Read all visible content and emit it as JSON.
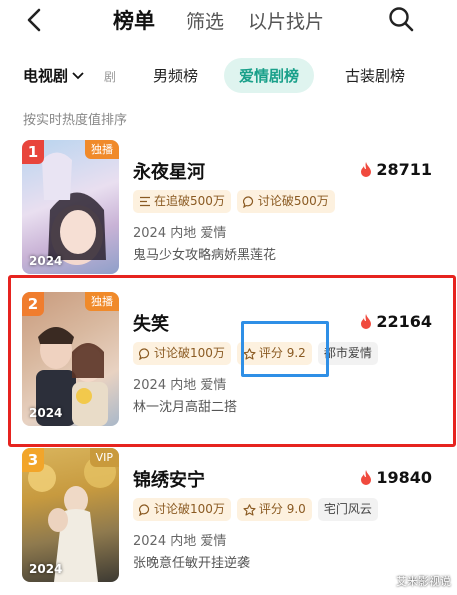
{
  "header": {
    "tabs": [
      "榜单",
      "筛选",
      "以片找片"
    ],
    "active_tab": 0
  },
  "filter": {
    "dropdown_label": "电视剧",
    "stub_text": "剧",
    "categories": [
      "男频榜",
      "爱情剧榜",
      "古装剧榜"
    ],
    "active_category": 1
  },
  "sort_hint": "按实时热度值排序",
  "items": [
    {
      "rank": "1",
      "badge": "独播",
      "title": "永夜星河",
      "heat": "28711",
      "chips": [
        {
          "icon": "list-icon",
          "text": "在追破500万",
          "style": "warm"
        },
        {
          "icon": "comment-icon",
          "text": "讨论破500万",
          "style": "warm"
        }
      ],
      "meta": "2024 内地 爱情",
      "desc": "鬼马少女攻略病娇黑莲花",
      "poster_year": "2024"
    },
    {
      "rank": "2",
      "badge": "独播",
      "title": "失笑",
      "heat": "22164",
      "chips": [
        {
          "icon": "comment-icon",
          "text": "讨论破100万",
          "style": "warm"
        },
        {
          "icon": "star-icon",
          "text": "评分 9.2",
          "style": "warm"
        },
        {
          "icon": "",
          "text": "都市爱情",
          "style": "gray"
        }
      ],
      "meta": "2024 内地 爱情",
      "desc": "林一沈月高甜二搭",
      "poster_year": "2024"
    },
    {
      "rank": "3",
      "badge": "VIP",
      "title": "锦绣安宁",
      "heat": "19840",
      "chips": [
        {
          "icon": "comment-icon",
          "text": "讨论破100万",
          "style": "warm"
        },
        {
          "icon": "star-icon",
          "text": "评分 9.0",
          "style": "warm"
        },
        {
          "icon": "",
          "text": "宅门风云",
          "style": "gray"
        }
      ],
      "meta": "2024 内地 爱情",
      "desc": "张晚意任敏开挂逆袭",
      "poster_year": "2024"
    }
  ],
  "watermark": "艾米影视说",
  "colors": {
    "accent": "#1aa08a",
    "rank1": "#e8453c",
    "rank2": "#f07d2e",
    "rank3": "#f2a52a",
    "fire": "#f04a3e",
    "highlight_red": "#e6231f",
    "highlight_blue": "#2f8fe6"
  }
}
